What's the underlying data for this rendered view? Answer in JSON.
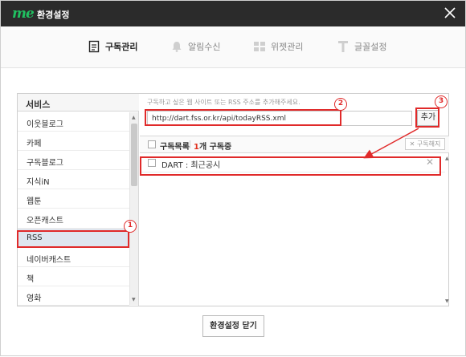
{
  "window": {
    "brand": "me",
    "title": "환경설정"
  },
  "tabs": [
    {
      "label": "구독관리",
      "icon": "document-icon",
      "active": true
    },
    {
      "label": "알림수신",
      "icon": "bell-icon",
      "active": false
    },
    {
      "label": "위젯관리",
      "icon": "widget-grid-icon",
      "active": false
    },
    {
      "label": "글꼴설정",
      "icon": "font-icon",
      "active": false
    }
  ],
  "services": {
    "header": "서비스",
    "items": [
      "이웃블로그",
      "카페",
      "구독블로그",
      "지식iN",
      "웹툰",
      "오픈캐스트",
      "RSS",
      "네이버캐스트",
      "책",
      "영화"
    ],
    "selected": "RSS"
  },
  "rss": {
    "guide": "구독하고 싶은 웹 사이트 또는 RSS 주소를 추가해주세요.",
    "url_value": "http://dart.fss.or.kr/api/todayRSS.xml",
    "add_label": "추가",
    "list_label": "구독목록",
    "count_num": "1",
    "count_text": "개 구독중",
    "unsubscribe_label": "구독해지",
    "feeds": [
      {
        "label": "DART : 최근공시"
      }
    ]
  },
  "footer": {
    "close_label": "환경설정 닫기"
  },
  "annotations": [
    {
      "num": "1"
    },
    {
      "num": "2"
    },
    {
      "num": "3"
    }
  ],
  "colors": {
    "titlebar": "#2b2b2b",
    "brand": "#20c060",
    "annotation": "#e02a2a",
    "count_highlight": "#e0301e"
  }
}
